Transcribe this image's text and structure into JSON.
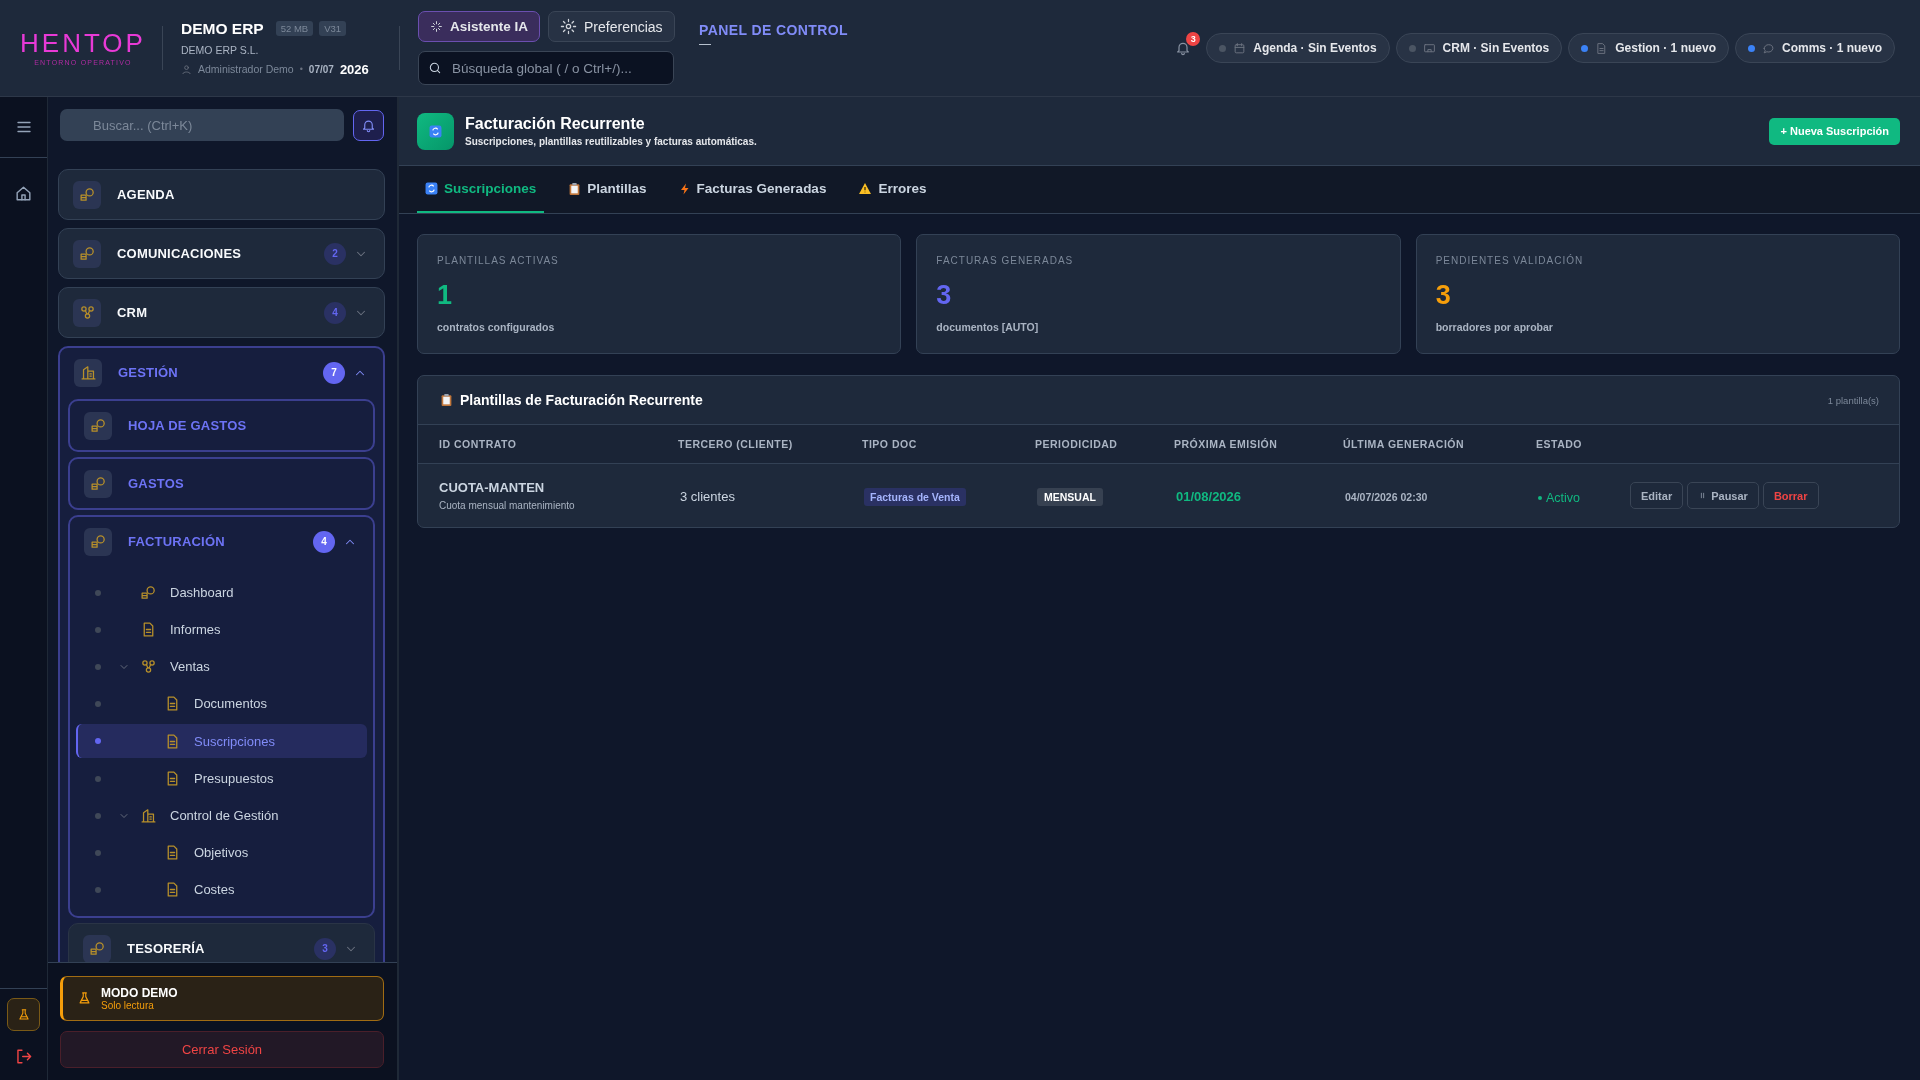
{
  "header": {
    "logo": {
      "name": "HENTOP",
      "tagline": "ENTORNO OPERATIVO"
    },
    "company": {
      "name": "DEMO ERP",
      "badges": [
        "52 MB",
        "V31"
      ],
      "legal_name": "DEMO ERP S.L.",
      "user": "Administrador Demo",
      "separator": "•",
      "date": "07/07",
      "year": "2026"
    },
    "buttons": [
      {
        "label": "Asistente IA",
        "selected": true
      },
      {
        "label": "Preferencias",
        "selected": false
      }
    ],
    "search": {
      "placeholder": "Búsqueda global ( / o Ctrl+/)..."
    },
    "panel": {
      "title": "PANEL DE CONTROL",
      "subtitle": "—"
    },
    "notifications": {
      "count": "3"
    },
    "pills": [
      {
        "label": "Agenda · Sin Eventos",
        "color": "#4b5563"
      },
      {
        "label": "CRM · Sin Eventos",
        "color": "#4b5563"
      },
      {
        "label": "Gestion · 1 nuevo",
        "color": "#3b82f6"
      },
      {
        "label": "Comms · 1 nuevo",
        "color": "#3b82f6"
      }
    ]
  },
  "sidebar": {
    "search": {
      "placeholder": "Buscar... (Ctrl+K)"
    },
    "sections": [
      {
        "label": "AGENDA",
        "active": false
      },
      {
        "label": "COMUNICACIONES",
        "count": "2",
        "active": false,
        "expanded": false
      },
      {
        "label": "CRM",
        "count": "4",
        "active": false,
        "expanded": false
      },
      {
        "label": "GESTIÓN",
        "count": "7",
        "active": true,
        "expanded": true,
        "children": [
          {
            "label": "HOJA DE GASTOS",
            "active": true
          },
          {
            "label": "GASTOS",
            "active": true
          },
          {
            "label": "FACTURACIÓN",
            "count": "4",
            "active": true,
            "expanded": true,
            "items": [
              {
                "label": "Dashboard",
                "selected": false
              },
              {
                "label": "Informes",
                "selected": false
              },
              {
                "label": "Ventas",
                "selected": false,
                "expanded": true,
                "children": [
                  {
                    "label": "Documentos",
                    "selected": false
                  },
                  {
                    "label": "Suscripciones",
                    "selected": true
                  },
                  {
                    "label": "Presupuestos",
                    "selected": false
                  }
                ]
              },
              {
                "label": "Control de Gestión",
                "selected": false,
                "expanded": true,
                "children": [
                  {
                    "label": "Objetivos",
                    "selected": false
                  },
                  {
                    "label": "Costes",
                    "selected": false
                  }
                ]
              }
            ]
          },
          {
            "label": "TESORERÍA",
            "count": "3",
            "active": false,
            "expanded": false
          }
        ]
      }
    ],
    "demo": {
      "title": "MODO DEMO",
      "subtitle": "Solo lectura"
    },
    "logout": "Cerrar Sesión"
  },
  "page": {
    "title": "Facturación Recurrente",
    "subtitle": "Suscripciones, plantillas reutilizables y facturas automáticas.",
    "action": "+ Nueva Suscripción"
  },
  "tabs": [
    {
      "label": "Suscripciones",
      "selected": true
    },
    {
      "label": "Plantillas",
      "selected": false
    },
    {
      "label": "Facturas Generadas",
      "selected": false
    },
    {
      "label": "Errores",
      "selected": false
    }
  ],
  "stats": [
    {
      "label": "PLANTILLAS ACTIVAS",
      "value": "1",
      "note": "contratos configurados",
      "color": "#10b981"
    },
    {
      "label": "FACTURAS GENERADAS",
      "value": "3",
      "note": "documentos [AUTO]",
      "color": "#6366f1"
    },
    {
      "label": "PENDIENTES VALIDACIÓN",
      "value": "3",
      "note": "borradores por aprobar",
      "color": "#f59e0b"
    }
  ],
  "table": {
    "title": "Plantillas de Facturación Recurrente",
    "count": "1 plantilla(s)",
    "columns": [
      "ID CONTRATO",
      "TERCERO (CLIENTE)",
      "TIPO DOC",
      "PERIODICIDAD",
      "PRÓXIMA EMISIÓN",
      "ÚLTIMA GENERACIÓN",
      "ESTADO"
    ],
    "rows": [
      {
        "id": "CUOTA-MANTEN",
        "description": "Cuota mensual mantenimiento",
        "client": "3 clientes",
        "doc_type": "Facturas de Venta",
        "periodicity": "MENSUAL",
        "next_issue": "01/08/2026",
        "last_generated": "04/07/2026 02:30",
        "status": "Activo",
        "active": true,
        "actions": [
          {
            "label": "Editar",
            "kind": "plain"
          },
          {
            "label": "Pausar",
            "kind": "pause"
          },
          {
            "label": "Borrar",
            "kind": "danger"
          }
        ]
      }
    ]
  }
}
